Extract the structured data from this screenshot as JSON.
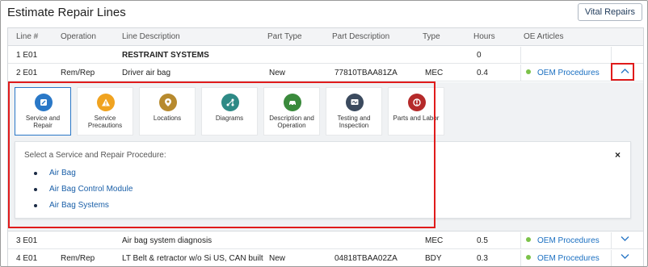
{
  "header": {
    "title": "Estimate Repair Lines",
    "vital_button": "Vital Repairs"
  },
  "table": {
    "columns": {
      "line": "Line #",
      "operation": "Operation",
      "description": "Line Description",
      "part_type": "Part Type",
      "part_description": "Part Description",
      "type": "Type",
      "hours": "Hours",
      "oe_articles": "OE Articles"
    },
    "rows": [
      {
        "line": "1 E01",
        "operation": "",
        "description": "RESTRAINT SYSTEMS",
        "part_type": "",
        "part_description": "",
        "type": "",
        "hours": "0",
        "oe": ""
      },
      {
        "line": "2 E01",
        "operation": "Rem/Rep",
        "description": "Driver air bag",
        "part_type": "New",
        "part_description": "77810TBAA81ZA",
        "type": "MEC",
        "hours": "0.4",
        "oe": "OEM Procedures"
      },
      {
        "line": "3 E01",
        "operation": "",
        "description": "Air bag system diagnosis",
        "part_type": "",
        "part_description": "",
        "type": "MEC",
        "hours": "0.5",
        "oe": "OEM Procedures"
      },
      {
        "line": "4 E01",
        "operation": "Rem/Rep",
        "description": "LT Belt & retractor w/o Si US, CAN built",
        "part_type": "New",
        "part_description": "04818TBAA02ZA",
        "type": "BDY",
        "hours": "0.3",
        "oe": "OEM Procedures"
      }
    ]
  },
  "tabs": [
    {
      "label": "Service and Repair",
      "icon": "wrench-icon",
      "color": "#2a78c7"
    },
    {
      "label": "Service Precautions",
      "icon": "warning-icon",
      "color": "#f0a320"
    },
    {
      "label": "Locations",
      "icon": "location-pin-icon",
      "color": "#b78a2e"
    },
    {
      "label": "Diagrams",
      "icon": "diagram-icon",
      "color": "#2e8a86"
    },
    {
      "label": "Description and Operation",
      "icon": "car-icon",
      "color": "#3a8a3c"
    },
    {
      "label": "Testing and Inspection",
      "icon": "test-monitor-icon",
      "color": "#3b4a5e"
    },
    {
      "label": "Parts and Labor",
      "icon": "parts-tag-icon",
      "color": "#b52a2a"
    }
  ],
  "procedures": {
    "heading": "Select a Service and Repair Procedure:",
    "close": "×",
    "items": [
      "Air Bag",
      "Air Bag Control Module",
      "Air Bag Systems"
    ]
  }
}
